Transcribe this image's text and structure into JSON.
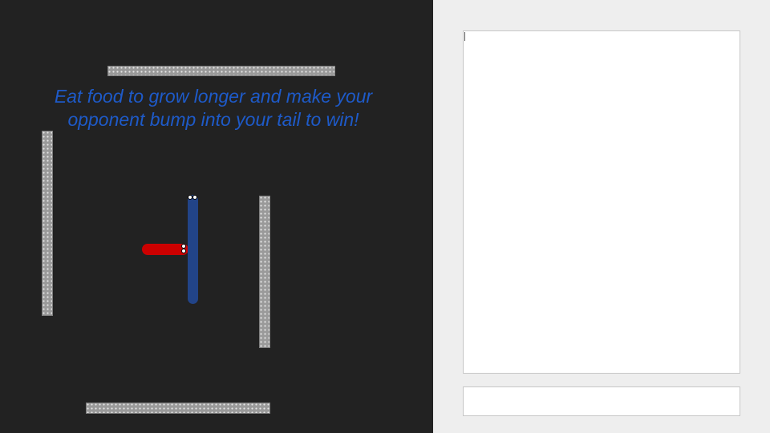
{
  "game": {
    "hint_text": "Eat food to grow longer and make your opponent bump into your tail to win!",
    "colors": {
      "background": "#222222",
      "hint": "#1e5ac8",
      "wall": "#9a9a9a",
      "player_red": "#cc0000",
      "player_blue": "#224488"
    },
    "snakes": [
      {
        "name": "red",
        "direction": "right"
      },
      {
        "name": "blue",
        "direction": "up"
      }
    ],
    "wall_count": 4
  },
  "sidebar": {
    "log_text": "",
    "chat_input": {
      "value": "",
      "placeholder": ""
    }
  }
}
